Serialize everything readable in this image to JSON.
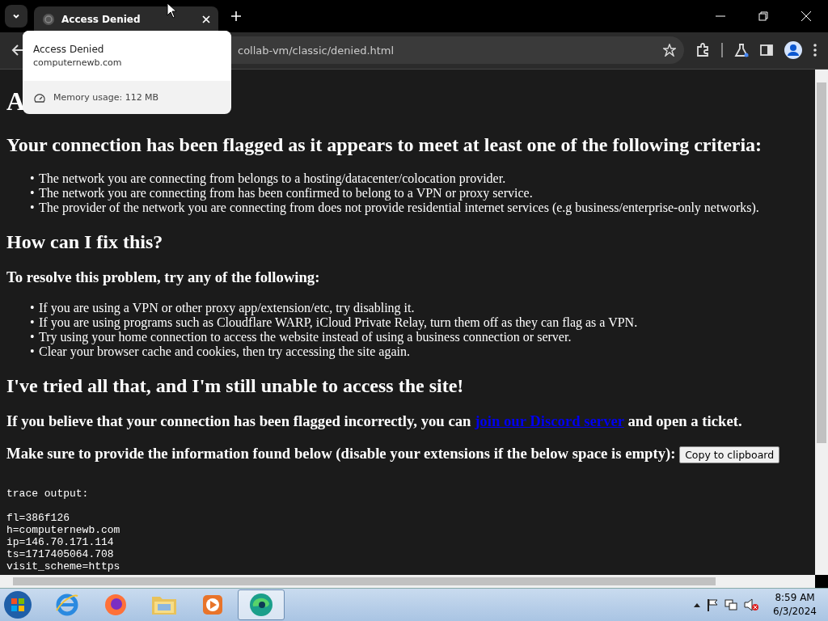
{
  "tab_strip": {
    "tabs": [
      {
        "title": "Access Denied",
        "selected": true
      }
    ]
  },
  "tab_hover_card": {
    "title": "Access Denied",
    "domain": "computernewb.com",
    "memory": "Memory usage: 112 MB"
  },
  "address_bar": {
    "url": "collab-vm/classic/denied.html"
  },
  "page": {
    "heading": "A",
    "subheading": "Your connection has been flagged as it appears to meet at least one of the following criteria:",
    "criteria": [
      {
        "marker": "•",
        "text": "The network you are connecting from belongs to a hosting/datacenter/colocation provider."
      },
      {
        "marker": "•",
        "text": "The network you are connecting from has been confirmed to belong to a VPN or proxy service."
      },
      {
        "marker": "•",
        "text": "The provider of the network you are connecting from does not provide residential internet services (e.g business/enterprise-only networks)."
      }
    ],
    "fix_heading": "How can I fix this?",
    "fix_intro": "To resolve this problem, try any of the following:",
    "fixes": [
      {
        "marker": "•",
        "text": "If you are using a VPN or other proxy app/extension/etc, try disabling it."
      },
      {
        "marker": "•",
        "text": "If you are using programs such as Cloudflare WARP, iCloud Private Relay, turn them off as they can flag as a VPN."
      },
      {
        "marker": "•",
        "text": "Try using your home connection to access the website instead of using a business connection or server."
      },
      {
        "marker": "•",
        "text": "Clear your browser cache and cookies, then try accessing the site again."
      }
    ],
    "tried_heading": "I've tried all that, and I'm still unable to access the site!",
    "ticket_text": {
      "before": "If you believe that your connection has been flagged incorrectly, you can",
      "link": "join our Discord server",
      "after": "and open a ticket."
    },
    "info_text": "Make sure to provide the information found below (disable your extensions if the below space is empty):",
    "copy_button": "Copy to clipboard",
    "trace_title": "trace output:",
    "trace_lines": [
      "fl=386f126",
      "h=computernewb.com",
      "ip=146.70.171.114",
      "ts=1717405064.708",
      "visit_scheme=https"
    ]
  },
  "taskbar": {
    "apps": [
      {
        "kind": "ie",
        "selected": false
      },
      {
        "kind": "firefox",
        "selected": false
      },
      {
        "kind": "folder",
        "selected": false
      },
      {
        "kind": "media",
        "selected": false
      },
      {
        "kind": "edge",
        "selected": true
      }
    ],
    "time": "8:59 AM",
    "date": "6/3/2024"
  }
}
